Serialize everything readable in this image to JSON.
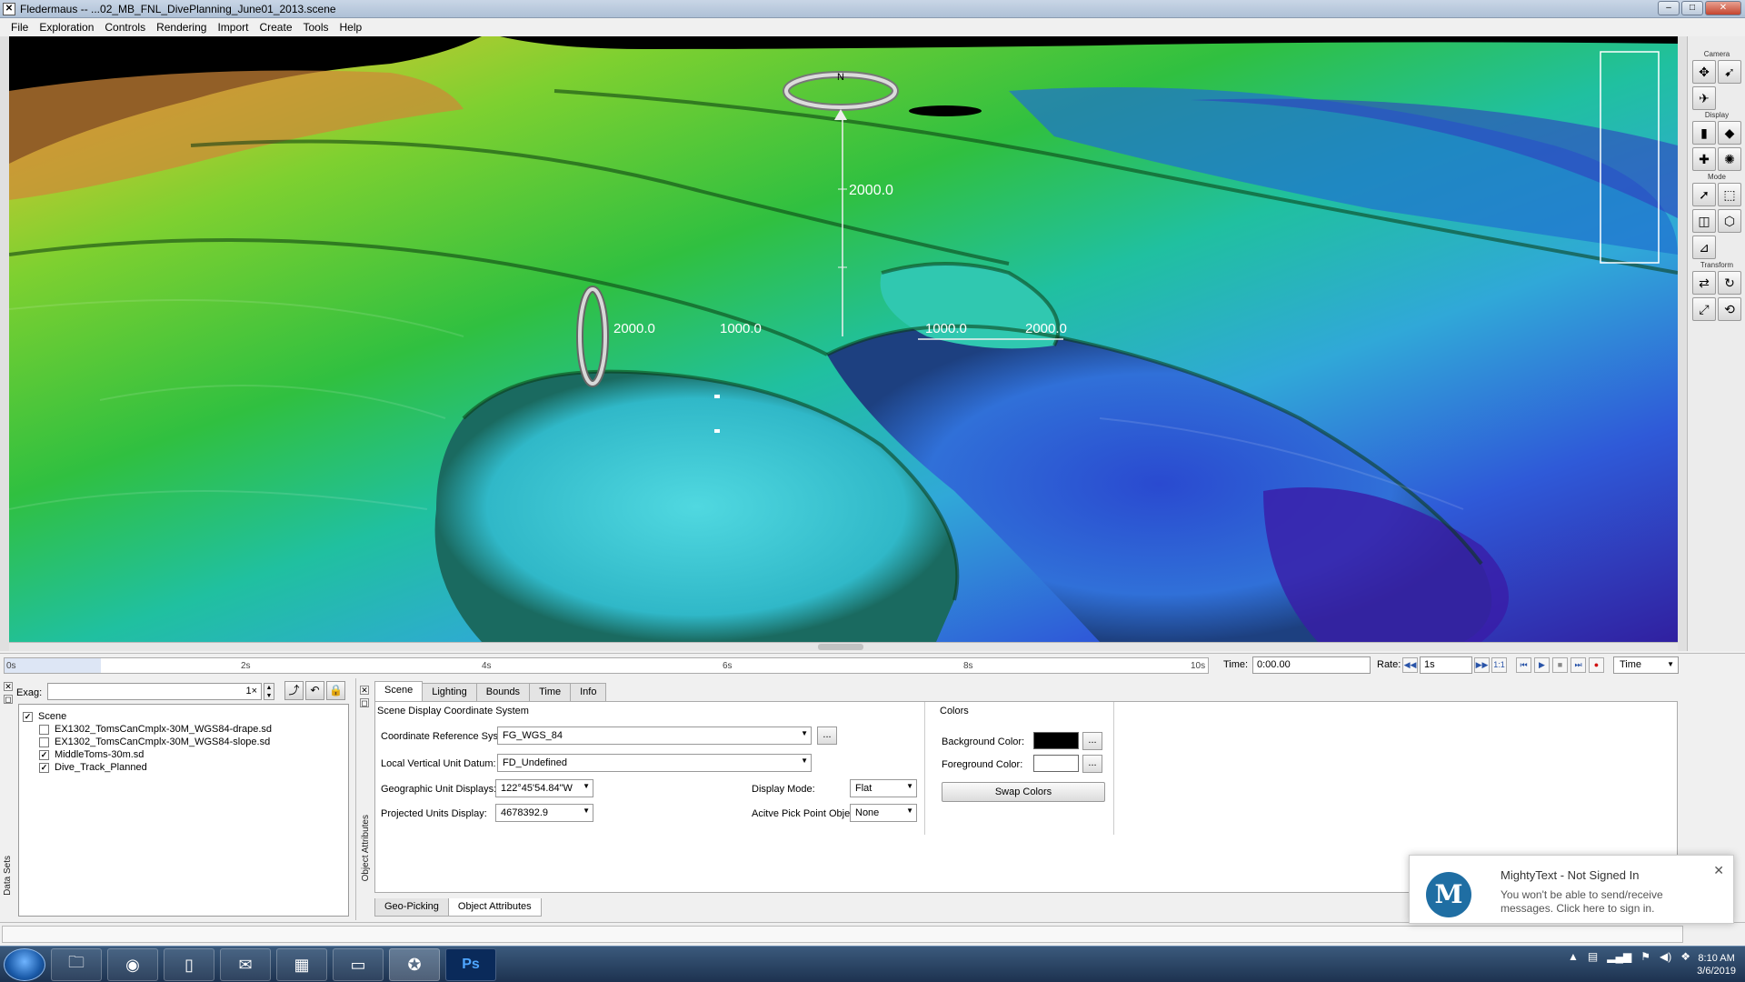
{
  "window": {
    "title": "Fledermaus -- ...02_MB_FNL_DivePlanning_June01_2013.scene",
    "app_icon": "fledermaus-icon",
    "buttons": {
      "minimize": "–",
      "maximize": "□",
      "close": "✕"
    }
  },
  "menu": [
    "File",
    "Exploration",
    "Controls",
    "Rendering",
    "Import",
    "Create",
    "Tools",
    "Help"
  ],
  "viewport": {
    "compass_label": "N",
    "scale_labels": {
      "vertical_top": "2000.0",
      "left_ring": "2000.0",
      "mid_left": "1000.0",
      "mid_right": "1000.0",
      "right": "2000.0"
    }
  },
  "right_toolbar": {
    "groups": [
      "Camera",
      "Display",
      "Mode",
      "Transform"
    ]
  },
  "timeline": {
    "ticks": [
      "0s",
      "2s",
      "4s",
      "6s",
      "8s",
      "10s"
    ],
    "progress": 0.08,
    "time_label": "Time:",
    "time_value": "0:00.00",
    "rate_label": "Rate:",
    "rate_value": "1s",
    "ratio_label": "1:1",
    "mode_select": "Time"
  },
  "data_sets": {
    "panel_label": "Data Sets",
    "exag_label": "Exag:",
    "exag_value": "1×",
    "tree": [
      {
        "label": "Scene",
        "checked": true,
        "level": 0
      },
      {
        "label": "EX1302_TomsCanCmplx-30M_WGS84-drape.sd",
        "checked": false,
        "level": 1
      },
      {
        "label": "EX1302_TomsCanCmplx-30M_WGS84-slope.sd",
        "checked": false,
        "level": 1
      },
      {
        "label": "MiddleToms-30m.sd",
        "checked": true,
        "level": 1
      },
      {
        "label": "Dive_Track_Planned",
        "checked": true,
        "level": 1
      }
    ]
  },
  "attributes": {
    "panel_label": "Object Attributes",
    "tabs": [
      "Scene",
      "Lighting",
      "Bounds",
      "Time",
      "Info"
    ],
    "active_tab": "Scene",
    "coord_group_title": "Scene Display Coordinate System",
    "crs_label": "Coordinate Reference System:",
    "crs_value": "FG_WGS_84",
    "vdatum_label": "Local Vertical Unit Datum:",
    "vdatum_value": "FD_Undefined",
    "geo_label": "Geographic Unit Displays:",
    "geo_value": "122°45'54.84\"W",
    "proj_label": "Projected Units Display:",
    "proj_value": "4678392.9",
    "display_mode_label": "Display Mode:",
    "display_mode_value": "Flat",
    "pick_label": "Acitve Pick Point Object:",
    "pick_value": "None",
    "colors_title": "Colors",
    "bg_label": "Background Color:",
    "bg_color": "#000000",
    "fg_label": "Foreground Color:",
    "fg_color": "#ffffff",
    "swap_label": "Swap Colors",
    "ellipsis": "...",
    "bottom_tabs": [
      "Geo-Picking",
      "Object Attributes"
    ],
    "active_bottom_tab": "Object Attributes"
  },
  "notification": {
    "logo": "M",
    "title": "MightyText - Not Signed In",
    "body": "You won't be able to send/receive messages. Click here to sign in."
  },
  "taskbar": {
    "apps": [
      "explorer-icon",
      "chrome-icon",
      "document-icon",
      "thunderbird-icon",
      "calculator-icon",
      "cmd-icon",
      "fledermaus-icon",
      "photoshop-icon"
    ],
    "ps_label": "Ps",
    "time": "8:10 AM",
    "date": "3/6/2019"
  }
}
